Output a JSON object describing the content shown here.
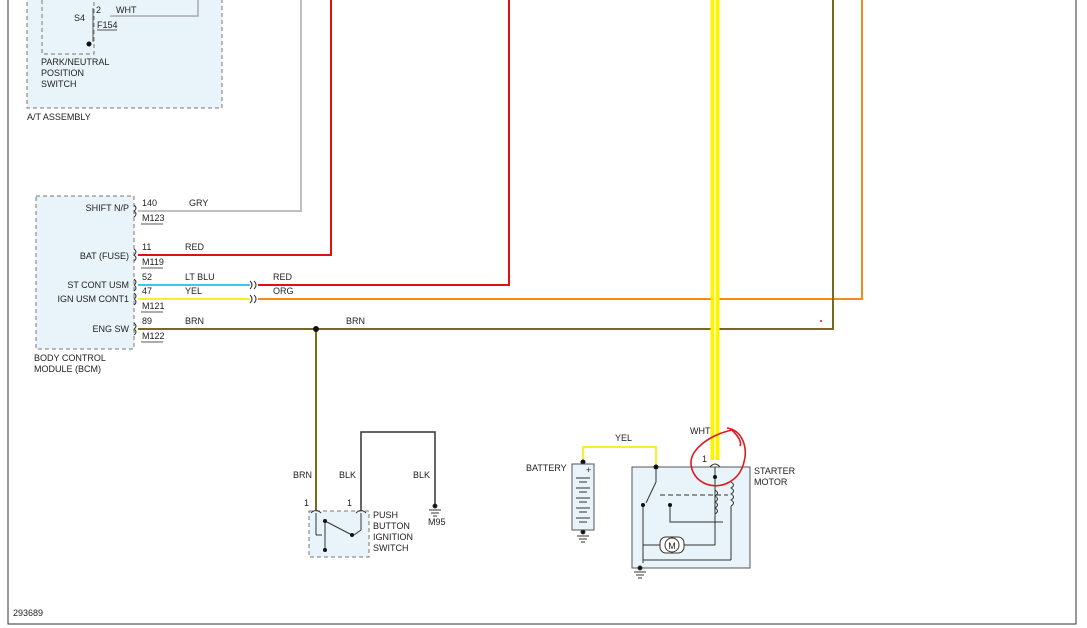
{
  "diagram_id": "293689",
  "at_assembly": {
    "label": "A/T ASSEMBLY",
    "pnp_switch": {
      "label_lines": [
        "PARK/NEUTRAL",
        "POSITION",
        "SWITCH"
      ],
      "terminal": "S4",
      "pin": "2",
      "wire": "WHT",
      "connector": "F154"
    }
  },
  "bcm": {
    "label_lines": [
      "BODY CONTROL",
      "MODULE (BCM)"
    ],
    "pins": [
      {
        "name": "SHIFT N/P",
        "pin": "140",
        "wire_color": "GRY",
        "connector": "M123"
      },
      {
        "name": "BAT (FUSE)",
        "pin": "11",
        "wire_color": "RED",
        "connector": "M119"
      },
      {
        "name": "ST CONT USM",
        "pin": "52",
        "wire_color": "LT BLU",
        "wire_color_2": "RED"
      },
      {
        "name": "IGN USM CONT1",
        "pin": "47",
        "wire_color": "YEL",
        "wire_color_2": "ORG",
        "connector": "M121"
      },
      {
        "name": "ENG SW",
        "pin": "89",
        "wire_color": "BRN",
        "wire_color_2": "BRN",
        "connector": "M122"
      }
    ]
  },
  "ignition_switch": {
    "label_lines": [
      "PUSH",
      "BUTTON",
      "IGNITION",
      "SWITCH"
    ],
    "left": {
      "wire": "BRN",
      "pin": "1"
    },
    "right": {
      "wire": "BLK",
      "pin": "1"
    },
    "ground": {
      "wire": "BLK",
      "label": "M95"
    }
  },
  "battery": {
    "label": "BATTERY",
    "plus": "+",
    "wire": "YEL"
  },
  "starter": {
    "label_lines": [
      "STARTER",
      "MOTOR"
    ],
    "wire": "WHT",
    "pin": "1",
    "motor": "M"
  },
  "colors": {
    "gry": "#c0c0c0",
    "red": "#e01010",
    "ltblu": "#33ccee",
    "yel": "#f7ef2a",
    "org": "#f58a1f",
    "brn": "#7a6a20",
    "wht_highlight": "#fff200",
    "annotation": "#e0191e"
  }
}
